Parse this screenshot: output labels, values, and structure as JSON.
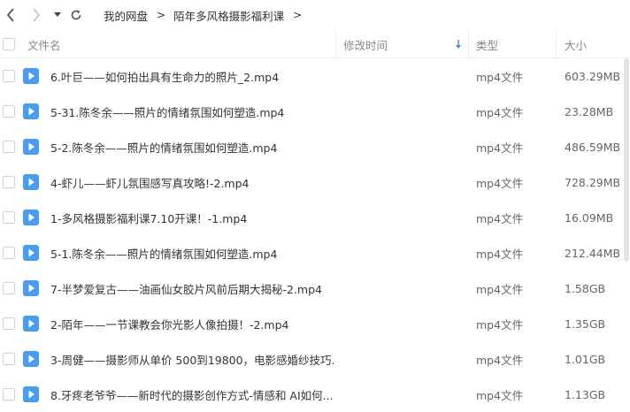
{
  "nav": {
    "back_icon": "chevron-left-icon",
    "forward_icon": "chevron-right-icon",
    "dropdown_icon": "caret-down-icon",
    "refresh_icon": "refresh-icon"
  },
  "breadcrumb": {
    "items": [
      "我的网盘",
      "陌年多风格摄影福利课"
    ],
    "separator": ">"
  },
  "table": {
    "headers": {
      "name": "文件名",
      "modified": "修改时间",
      "type": "类型",
      "size": "大小"
    },
    "sort_icon": "sort-down-arrow-icon",
    "rows": [
      {
        "name": "6.叶巨——如何拍出具有生命力的照片_2.mp4",
        "type": "mp4文件",
        "size": "603.29MB"
      },
      {
        "name": "5-31.陈冬余——照片的情绪氛围如何塑造.mp4",
        "type": "mp4文件",
        "size": "23.28MB"
      },
      {
        "name": "5-2.陈冬余——照片的情绪氛围如何塑造.mp4",
        "type": "mp4文件",
        "size": "486.59MB"
      },
      {
        "name": "4-虾儿——虾儿氛围感写真攻略!-2.mp4",
        "type": "mp4文件",
        "size": "728.29MB"
      },
      {
        "name": "1-多风格摄影福利课7.10开课！-1.mp4",
        "type": "mp4文件",
        "size": "16.09MB"
      },
      {
        "name": "5-1.陈冬余——照片的情绪氛围如何塑造.mp4",
        "type": "mp4文件",
        "size": "212.44MB"
      },
      {
        "name": "7-半梦爱复古——油画仙女胶片风前后期大揭秘-2.mp4",
        "type": "mp4文件",
        "size": "1.58GB"
      },
      {
        "name": "2-陌年——一节课教会你光影人像拍摄！-2.mp4",
        "type": "mp4文件",
        "size": "1.35GB"
      },
      {
        "name": "3-周健——摄影师从单价 500到19800，电影感婚纱技巧...",
        "type": "mp4文件",
        "size": "1.01GB"
      },
      {
        "name": "8.牙疼老爷爷——新时代的摄影创作方式-情感和 AI如何...",
        "type": "mp4文件",
        "size": "1.13GB"
      }
    ]
  },
  "colors": {
    "icon_blue": "#4a9cf0",
    "sort_arrow": "#3a8ee6"
  }
}
